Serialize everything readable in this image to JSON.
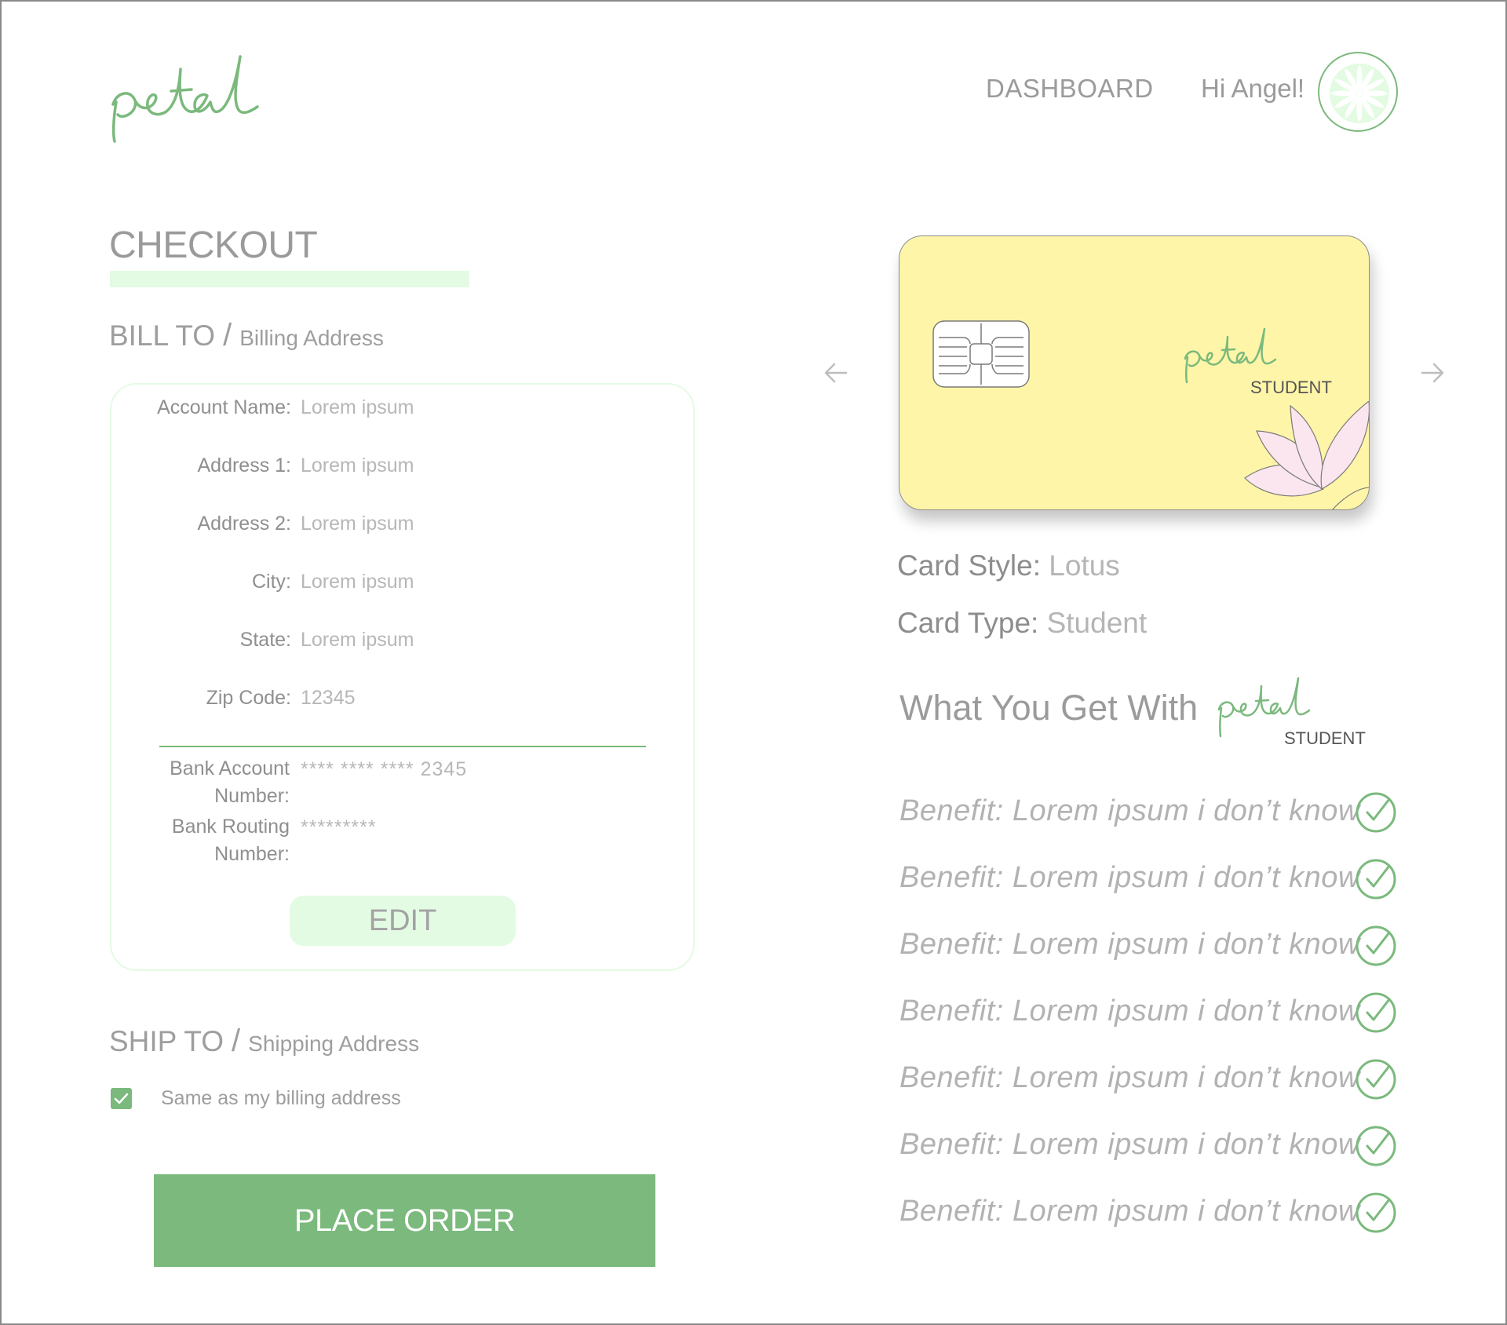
{
  "header": {
    "logo_text": "petal",
    "nav_dashboard": "DASHBOARD",
    "greeting": "Hi Angel!"
  },
  "checkout": {
    "title": "CHECKOUT",
    "bill_to": {
      "heading": "BILL TO",
      "separator": "/",
      "subheading": "Billing Address"
    },
    "fields": [
      {
        "label": "Account Name:",
        "value": "Lorem ipsum"
      },
      {
        "label": "Address 1:",
        "value": "Lorem ipsum"
      },
      {
        "label": "Address 2:",
        "value": "Lorem ipsum"
      },
      {
        "label": "City:",
        "value": "Lorem ipsum"
      },
      {
        "label": "State:",
        "value": "Lorem ipsum"
      },
      {
        "label": "Zip Code:",
        "value": "12345"
      }
    ],
    "bank": {
      "account_label_1": "Bank Account",
      "account_label_2": "Number:",
      "account_value": "**** **** **** 2345",
      "routing_label_1": "Bank Routing",
      "routing_label_2": "Number:",
      "routing_value": "*********"
    },
    "edit_label": "EDIT",
    "ship_to": {
      "heading": "SHIP TO",
      "separator": "/",
      "subheading": "Shipping Address"
    },
    "same_as_billing": {
      "label": "Same as my billing address",
      "checked": true
    },
    "place_order_label": "PLACE ORDER"
  },
  "card": {
    "logo_text": "petal",
    "type_label": "STUDENT",
    "style_key": "Card Style:",
    "style_value": "Lotus",
    "type_key": "Card Type:",
    "type_value": "Student",
    "colors": {
      "card_bg": "#fff5a8",
      "petal": "#fbe6ef",
      "accent": "#7bb97d"
    }
  },
  "benefits": {
    "heading": "What You Get With",
    "logo_text": "petal",
    "logo_sub": "STUDENT",
    "items": [
      "Benefit: Lorem ipsum i don’t know",
      "Benefit: Lorem ipsum i don’t know",
      "Benefit: Lorem ipsum i don’t know",
      "Benefit: Lorem ipsum i don’t know",
      "Benefit: Lorem ipsum i don’t know",
      "Benefit: Lorem ipsum i don’t know",
      "Benefit: Lorem ipsum i don’t know"
    ]
  },
  "icons": {
    "avatar": "flower-avatar-icon",
    "prev": "arrow-left-icon",
    "next": "arrow-right-icon",
    "check": "check-circle-icon",
    "checkbox": "checkbox-checked-icon"
  }
}
